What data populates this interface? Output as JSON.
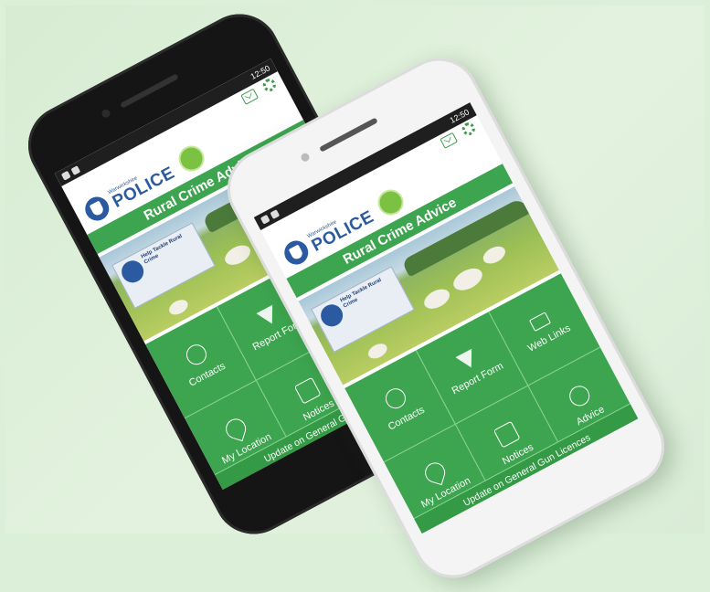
{
  "app": {
    "org_small": "Warwickshire",
    "org_name": "POLICE",
    "title": "Rural Crime Advice",
    "sign_text": "Help Tackle Rural Crime",
    "status_left": "",
    "status_right": "12:50"
  },
  "menu": [
    {
      "label": "Contacts",
      "icon": "contacts-icon"
    },
    {
      "label": "Report Form",
      "icon": "report-form-icon"
    },
    {
      "label": "Web Links",
      "icon": "web-links-icon"
    },
    {
      "label": "My Location",
      "icon": "location-pin-icon"
    },
    {
      "label": "Notices",
      "icon": "calendar-icon"
    },
    {
      "label": "Advice",
      "icon": "info-icon"
    }
  ],
  "footer": {
    "label": "Update on General Gun Licences"
  },
  "colors": {
    "accent": "#3da54f",
    "brand_blue": "#2c5aa0",
    "background": "#dcefd9"
  }
}
